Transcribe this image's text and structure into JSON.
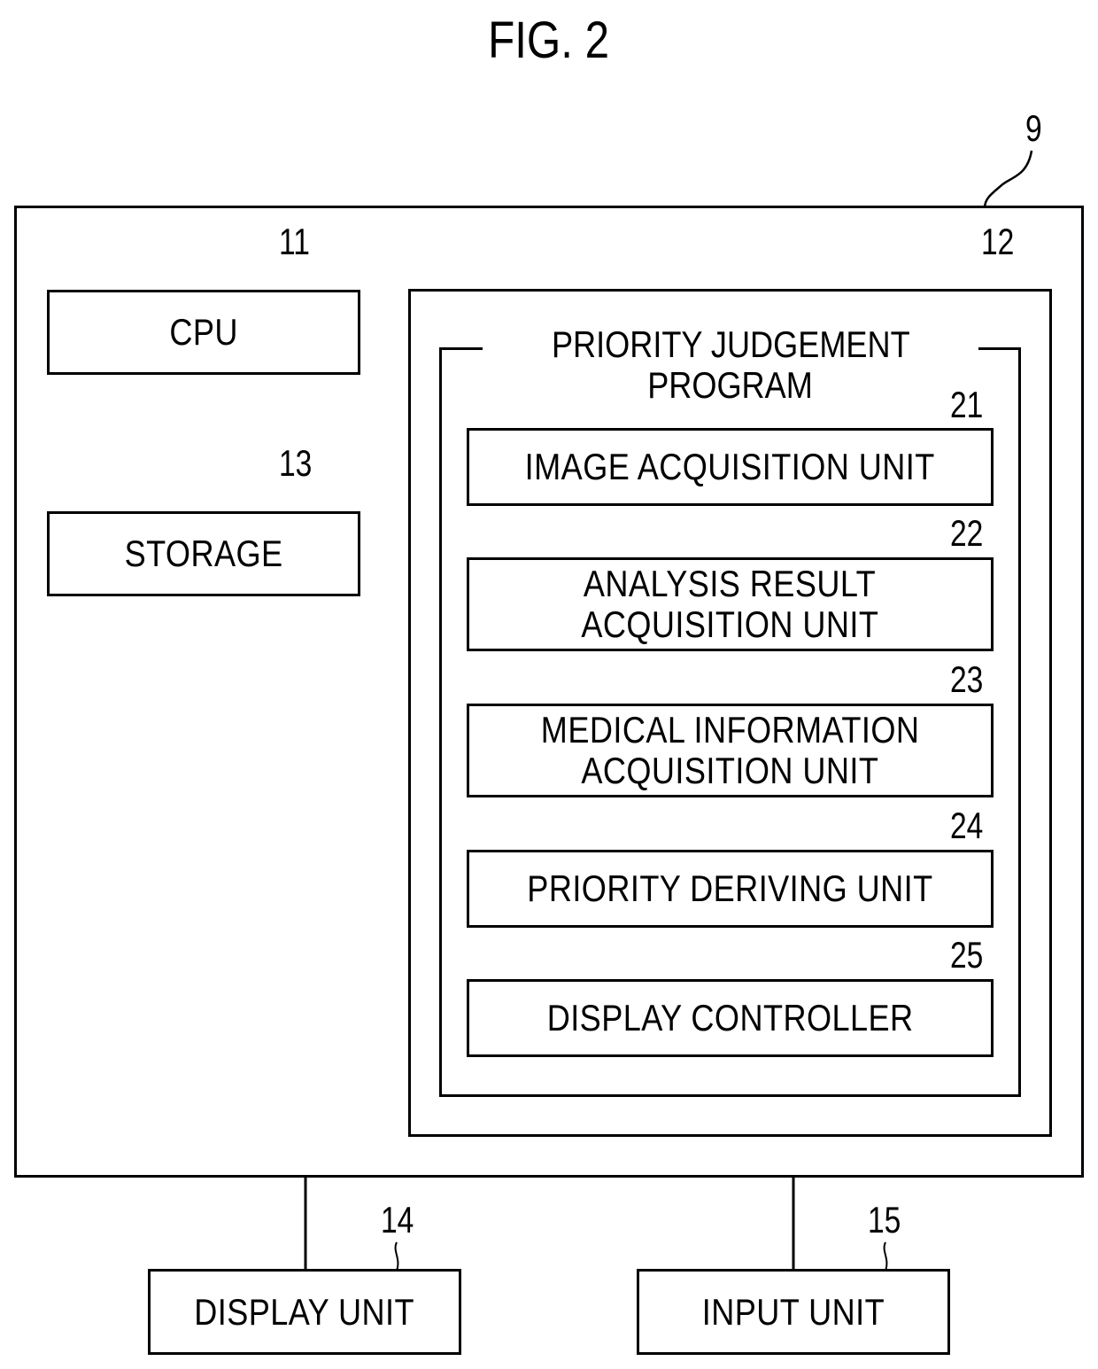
{
  "figure": {
    "title": "FIG. 2"
  },
  "blocks": {
    "device": {
      "ref": "9"
    },
    "cpu": {
      "ref": "11",
      "label": "CPU"
    },
    "memory": {
      "ref": "12"
    },
    "storage": {
      "ref": "13",
      "label": "STORAGE"
    },
    "display_unit": {
      "ref": "14",
      "label": "DISPLAY UNIT"
    },
    "input_unit": {
      "ref": "15",
      "label": "INPUT UNIT"
    }
  },
  "program": {
    "label_line1": "PRIORITY JUDGEMENT",
    "label_line2": "PROGRAM",
    "units": [
      {
        "ref": "21",
        "line1": "IMAGE ACQUISITION UNIT",
        "line2": ""
      },
      {
        "ref": "22",
        "line1": "ANALYSIS RESULT",
        "line2": "ACQUISITION UNIT"
      },
      {
        "ref": "23",
        "line1": "MEDICAL INFORMATION",
        "line2": "ACQUISITION UNIT"
      },
      {
        "ref": "24",
        "line1": "PRIORITY DERIVING UNIT",
        "line2": ""
      },
      {
        "ref": "25",
        "line1": "DISPLAY CONTROLLER",
        "line2": ""
      }
    ]
  }
}
